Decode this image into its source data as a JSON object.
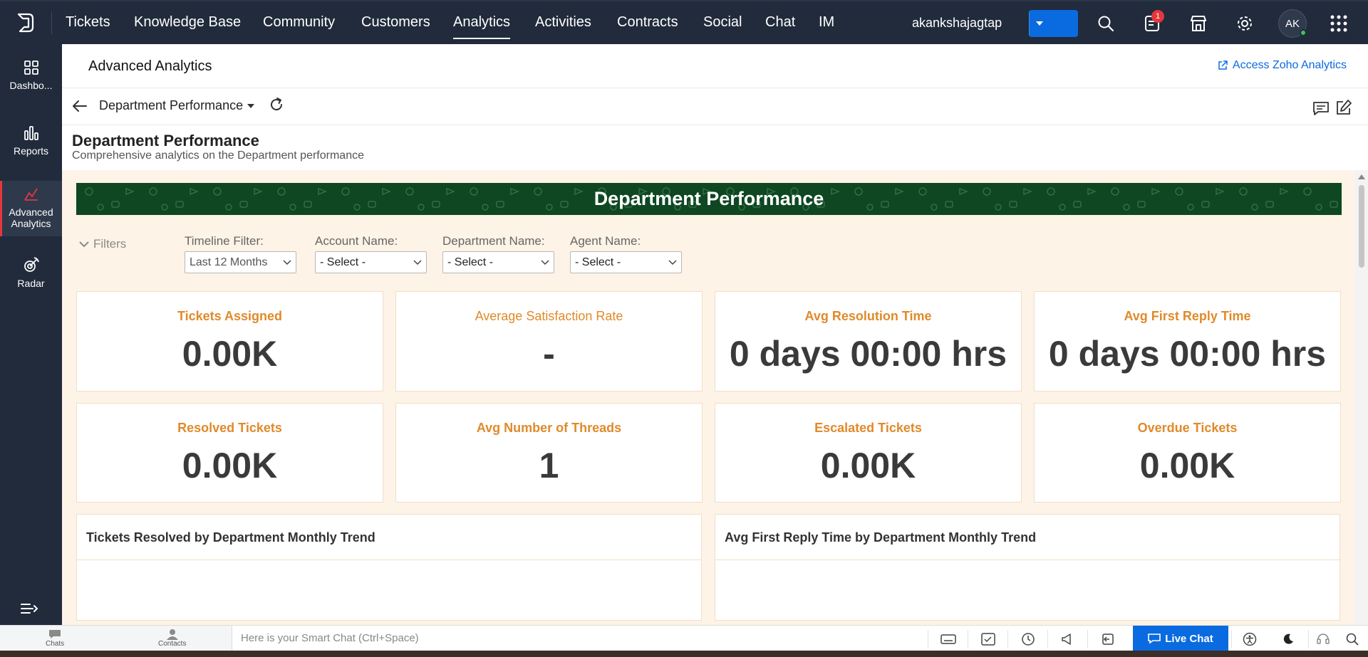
{
  "topnav": {
    "tabs": [
      {
        "label": "Tickets"
      },
      {
        "label": "Knowledge Base"
      },
      {
        "label": "Community"
      },
      {
        "label": "Customers"
      },
      {
        "label": "Analytics",
        "active": true
      },
      {
        "label": "Activities"
      },
      {
        "label": "Contracts"
      },
      {
        "label": "Social"
      },
      {
        "label": "Chat"
      },
      {
        "label": "IM"
      }
    ],
    "username": "akankshajagtap",
    "plus_label": "+",
    "notification_count": "1",
    "avatar_initials": "AK",
    "icons": [
      "search-icon",
      "notifications-icon",
      "marketplace-icon",
      "settings-icon",
      "apps-grid-icon"
    ]
  },
  "sidebar": {
    "items": [
      {
        "label": "Dashbo...",
        "icon": "dashboards-icon"
      },
      {
        "label": "Reports",
        "icon": "reports-icon"
      },
      {
        "label": "Advanced Analytics",
        "icon": "advanced-analytics-icon",
        "active": true
      },
      {
        "label": "Radar",
        "icon": "radar-icon"
      }
    ]
  },
  "header": {
    "title": "Advanced Analytics",
    "zoho_link": "Access Zoho Analytics"
  },
  "report": {
    "selector": "Department Performance",
    "title": "Department Performance",
    "subtitle": "Comprehensive analytics on the Department performance"
  },
  "dashboard": {
    "banner": "Department Performance",
    "filters_toggle": "Filters",
    "filters": [
      {
        "label": "Timeline Filter:",
        "value": "Last 12 Months"
      },
      {
        "label": "Account Name:",
        "value": "- Select -"
      },
      {
        "label": "Department Name:",
        "value": "- Select -"
      },
      {
        "label": "Agent Name:",
        "value": "- Select -"
      }
    ],
    "kpis": [
      {
        "title": "Tickets Assigned",
        "value": "0.00K"
      },
      {
        "title": "Average Satisfaction Rate",
        "value": "-"
      },
      {
        "title": "Avg Resolution Time",
        "value": "0 days 00:00 hrs"
      },
      {
        "title": "Avg First Reply Time",
        "value": "0 days 00:00 hrs"
      },
      {
        "title": "Resolved Tickets",
        "value": "0.00K"
      },
      {
        "title": "Avg Number of Threads",
        "value": "1"
      },
      {
        "title": "Escalated Tickets",
        "value": "0.00K"
      },
      {
        "title": "Overdue Tickets",
        "value": "0.00K"
      }
    ],
    "charts": [
      {
        "title": "Tickets Resolved by Department Monthly Trend"
      },
      {
        "title": "Avg First Reply Time by Department Monthly Trend"
      }
    ]
  },
  "bottombar": {
    "chats_label": "Chats",
    "contacts_label": "Contacts",
    "smart_chat_placeholder": "Here is your Smart Chat (Ctrl+Space)",
    "live_chat_label": "Live Chat",
    "icons": [
      "keyboard-icon",
      "checklist-icon",
      "history-icon",
      "announcement-icon",
      "switch-icon",
      "accessibility-icon",
      "dark-mode-icon",
      "support-icon",
      "search-icon"
    ]
  },
  "colors": {
    "nav_bg": "#212b3c",
    "accent_blue": "#0a6be0",
    "kpi_title": "#e08a2a",
    "banner_green": "#0e4722",
    "canvas_bg": "#fdf3e6"
  }
}
